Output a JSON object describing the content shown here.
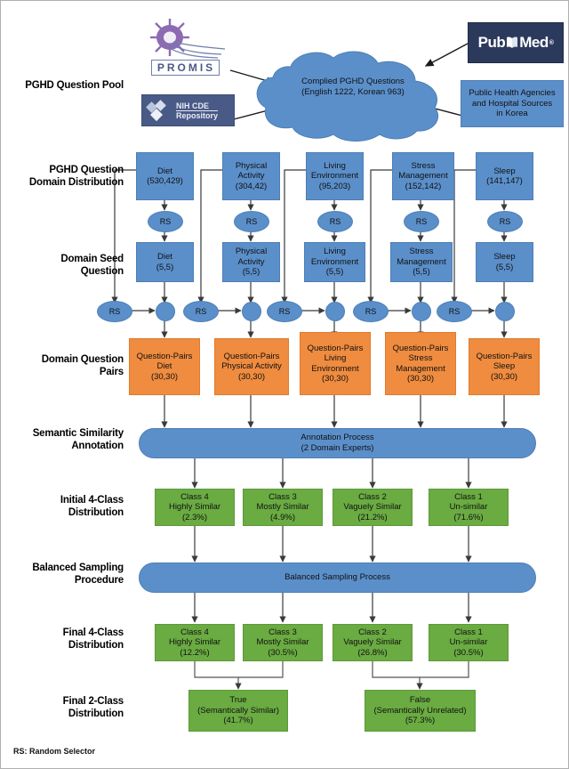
{
  "stage_labels": {
    "pool": "PGHD Question Pool",
    "domain_distribution": "PGHD Question\nDomain Distribution",
    "seed": "Domain Seed\nQuestion",
    "pairs": "Domain Question\nPairs",
    "annotation": "Semantic Similarity\nAnnotation",
    "initial4": "Initial 4-Class\nDistribution",
    "balanced": "Balanced Sampling\nProcedure",
    "final4": "Final 4-Class\nDistribution",
    "final2": "Final 2-Class\nDistribution"
  },
  "sources": {
    "promis": {
      "name": "PROMIS",
      "icon": "promis-starburst-logo"
    },
    "nih_cde": {
      "line1": "NIH CDE",
      "line2": "Repository",
      "icon": "nih-cde-diamonds-logo"
    },
    "pubmed": {
      "part1": "Pub",
      "part2": "Med",
      "registered": "®",
      "icon": "pubmed-book-logo"
    },
    "public_health": {
      "line1": "Public Health Agencies",
      "line2": "and Hospital Sources",
      "line3": "in Korea"
    }
  },
  "cloud": {
    "line1": "Complied PGHD Questions",
    "line2": "(English 1222, Korean 963)"
  },
  "rs_label": "RS",
  "domains": [
    {
      "name": "Diet",
      "name_l2": "",
      "pool_count": "(530,429)",
      "seed_count": "(5,5)",
      "pairs_title_l1": "Question-Pairs",
      "pairs_title_l2": "Diet",
      "pairs_title_l3": "",
      "pairs_count": "(30,30)"
    },
    {
      "name": "Physical",
      "name_l2": "Activity",
      "pool_count": "(304,42)",
      "seed_count": "(5,5)",
      "pairs_title_l1": "Question-Pairs",
      "pairs_title_l2": "Physical Activity",
      "pairs_title_l3": "",
      "pairs_count": "(30,30)"
    },
    {
      "name": "Living",
      "name_l2": "Environment",
      "pool_count": "(95,203)",
      "seed_count": "(5,5)",
      "pairs_title_l1": "Question-Pairs",
      "pairs_title_l2": "Living",
      "pairs_title_l3": "Environment",
      "pairs_count": "(30,30)"
    },
    {
      "name": "Stress",
      "name_l2": "Management",
      "pool_count": "(152,142)",
      "seed_count": "(5,5)",
      "pairs_title_l1": "Question-Pairs",
      "pairs_title_l2": "Stress",
      "pairs_title_l3": "Management",
      "pairs_count": "(30,30)"
    },
    {
      "name": "Sleep",
      "name_l2": "",
      "pool_count": "(141,147)",
      "seed_count": "(5,5)",
      "pairs_title_l1": "Question-Pairs",
      "pairs_title_l2": "Sleep",
      "pairs_title_l3": "",
      "pairs_count": "(30,30)"
    }
  ],
  "annotation_process": {
    "line1": "Annotation Process",
    "line2": "(2 Domain Experts)"
  },
  "balanced_process": {
    "line1": "Balanced Sampling Process"
  },
  "initial_classes": [
    {
      "class": "Class 4",
      "label": "Highly Similar",
      "pct": "(2.3%)"
    },
    {
      "class": "Class 3",
      "label": "Mostly Similar",
      "pct": "(4.9%)"
    },
    {
      "class": "Class 2",
      "label": "Vaguely Similar",
      "pct": "(21.2%)"
    },
    {
      "class": "Class 1",
      "label": "Un-similar",
      "pct": "(71.6%)"
    }
  ],
  "final_classes": [
    {
      "class": "Class 4",
      "label": "Highly Similar",
      "pct": "(12.2%)"
    },
    {
      "class": "Class 3",
      "label": "Mostly Similar",
      "pct": "(30.5%)"
    },
    {
      "class": "Class 2",
      "label": "Vaguely Similar",
      "pct": "(26.8%)"
    },
    {
      "class": "Class 1",
      "label": "Un-similar",
      "pct": "(30.5%)"
    }
  ],
  "binary_classes": [
    {
      "name": "True",
      "label": "(Semantically Similar)",
      "pct": "(41.7%)"
    },
    {
      "name": "False",
      "label": "(Semantically Unrelated)",
      "pct": "(57.3%)"
    }
  ],
  "footnote": "RS: Random Selector",
  "colors": {
    "blue": "#5b8fca",
    "orange": "#ef8c3f",
    "green": "#6aab42",
    "pubmed_navy": "#2b3a5c",
    "nih_blue": "#4a5a86",
    "promis_purple": "#8c6bb1"
  }
}
